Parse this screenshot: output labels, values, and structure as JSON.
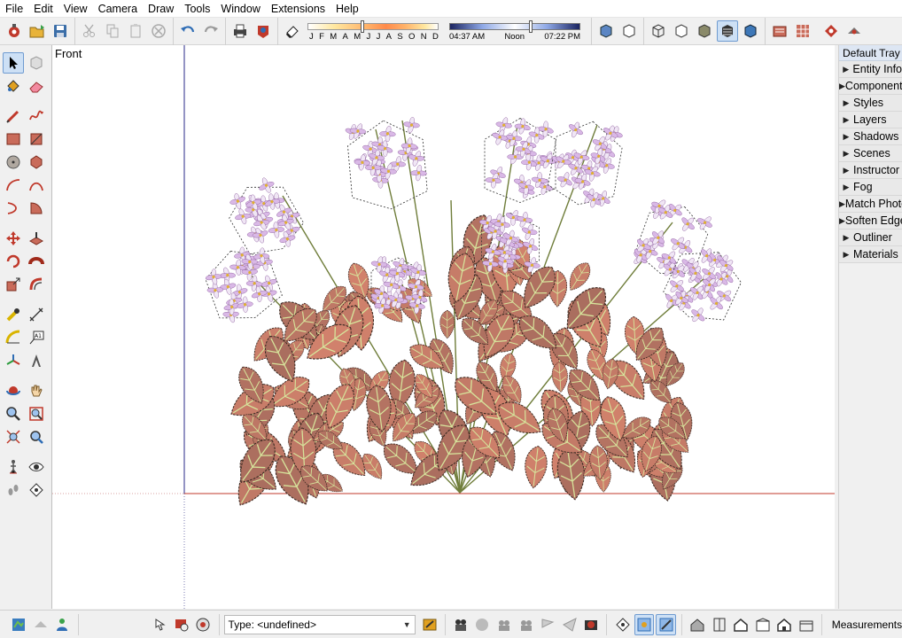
{
  "menu": [
    "File",
    "Edit",
    "View",
    "Camera",
    "Draw",
    "Tools",
    "Window",
    "Extensions",
    "Help"
  ],
  "shadow": {
    "months": [
      "J",
      "F",
      "M",
      "A",
      "M",
      "J",
      "J",
      "A",
      "S",
      "O",
      "N",
      "D"
    ],
    "time_start": "04:37 AM",
    "time_mid": "Noon",
    "time_end": "07:22 PM"
  },
  "viewport": {
    "view_name": "Front"
  },
  "tray": {
    "title": "Default Tray",
    "panels": [
      "Entity Info",
      "Components",
      "Styles",
      "Layers",
      "Shadows",
      "Scenes",
      "Instructor",
      "Fog",
      "Match Photo",
      "Soften Edges",
      "Outliner",
      "Materials"
    ]
  },
  "statusbar": {
    "type_text": "Type: <undefined>",
    "measurements_label": "Measurements"
  },
  "colors": {
    "accent": "#cde0f5",
    "leaf": "#b97a6a",
    "flower": "#e8d8ef"
  }
}
